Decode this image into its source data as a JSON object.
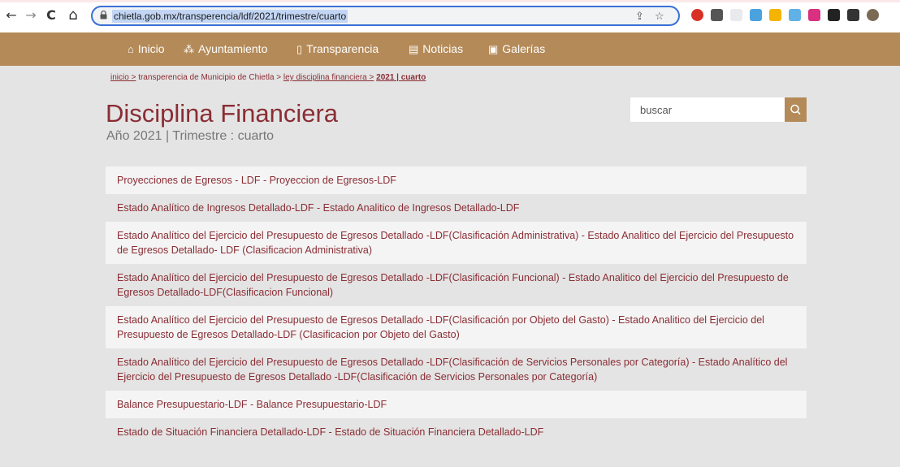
{
  "browser": {
    "url": "chietla.gob.mx/transperencia/ldf/2021/trimestre/cuarto",
    "back_icon": "←",
    "forward_icon": "→",
    "reload_icon": "C",
    "home_icon": "⌂",
    "share_icon": "⇪",
    "star_icon": "☆",
    "extension_colors": [
      "#d93025",
      "#555555",
      "#e8eaed",
      "#4aa3df",
      "#f4b400",
      "#5fb1e6",
      "#d93080",
      "#222222",
      "#333333",
      "#7a6a55"
    ]
  },
  "nav": {
    "items": [
      {
        "label": "Inicio",
        "icon": "⌂"
      },
      {
        "label": "Ayuntamiento",
        "icon": "⁂"
      },
      {
        "label": "Transparencia",
        "icon": "▯"
      },
      {
        "label": "Noticias",
        "icon": "▤"
      },
      {
        "label": "Galerías",
        "icon": "▣"
      }
    ]
  },
  "breadcrumb": {
    "inicio": "inicio >",
    "transparencia": "transperencia de Municipio de Chietla >",
    "ley": "ley disciplina financiera >",
    "current": "2021 | cuarto"
  },
  "page": {
    "title": "Disciplina Financiera",
    "subtitle": "Año 2021 | Trimestre : cuarto"
  },
  "search": {
    "placeholder": "buscar",
    "icon": "search-icon"
  },
  "documents": [
    "Proyecciones de Egresos - LDF - Proyeccion de Egresos-LDF",
    "Estado Analítico de Ingresos Detallado-LDF - Estado Analitico de Ingresos Detallado-LDF",
    "Estado Analítico del Ejercicio del Presupuesto de Egresos Detallado -LDF(Clasificación Administrativa) - Estado Analitico del Ejercicio del Presupuesto de Egresos Detallado- LDF (Clasificacion Administrativa)",
    "Estado Analítico del Ejercicio del Presupuesto de Egresos Detallado -LDF(Clasificación Funcional) - Estado Analitico del Ejercicio del Presupuesto de Egresos Detallado-LDF(Clasificacion Funcional)",
    "Estado Analítico del Ejercicio del Presupuesto de Egresos Detallado -LDF(Clasificación por Objeto del Gasto) - Estado Analitico del Ejercicio del Presupuesto de Egresos Detallado-LDF (Clasificacion por Objeto del Gasto)",
    "Estado Analítico del Ejercicio del Presupuesto de Egresos Detallado -LDF(Clasificación de Servicios Personales por Categoría) - Estado Analítico del Ejercicio del Presupuesto de Egresos Detallado -LDF(Clasificación de Servicios Personales por Categoría)",
    "Balance Presupuestario-LDF - Balance Presupuestario-LDF",
    "Estado de Situación Financiera Detallado-LDF - Estado de Situación Financiera Detallado-LDF"
  ],
  "colors": {
    "accent": "#b48a58",
    "maroon": "#8a2d34",
    "background": "#e4e4e4"
  }
}
